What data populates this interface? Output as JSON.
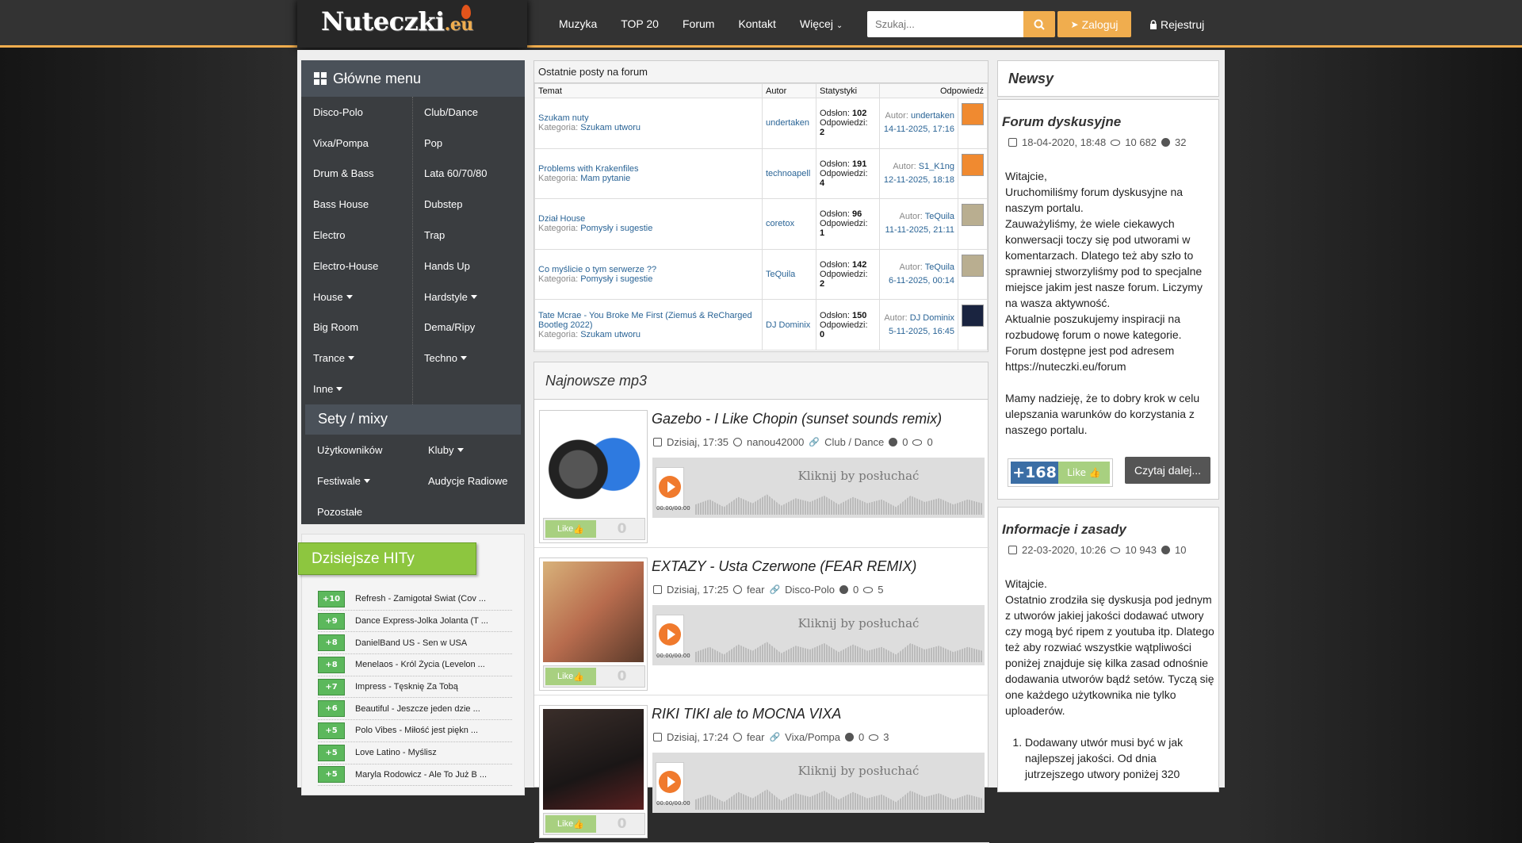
{
  "logo": {
    "text": "Nuteczki",
    "suffix": ".eu"
  },
  "nav": {
    "items": [
      "Muzyka",
      "TOP 20",
      "Forum",
      "Kontakt"
    ],
    "more": "Więcej"
  },
  "search": {
    "placeholder": "Szukaj..."
  },
  "auth": {
    "login": "Zaloguj",
    "register": "Rejestruj"
  },
  "sidebar": {
    "title": "Główne menu",
    "items": [
      {
        "label": "Disco-Polo",
        "caret": false
      },
      {
        "label": "Club/Dance",
        "caret": false
      },
      {
        "label": "Vixa/Pompa",
        "caret": false
      },
      {
        "label": "Pop",
        "caret": false
      },
      {
        "label": "Drum & Bass",
        "caret": false
      },
      {
        "label": "Lata 60/70/80",
        "caret": false
      },
      {
        "label": "Bass House",
        "caret": false
      },
      {
        "label": "Dubstep",
        "caret": false
      },
      {
        "label": "Electro",
        "caret": false
      },
      {
        "label": "Trap",
        "caret": false
      },
      {
        "label": "Electro-House",
        "caret": false
      },
      {
        "label": "Hands Up",
        "caret": false
      },
      {
        "label": "House",
        "caret": true
      },
      {
        "label": "Hardstyle",
        "caret": true
      },
      {
        "label": "Big Room",
        "caret": false
      },
      {
        "label": "Dema/Ripy",
        "caret": false
      },
      {
        "label": "Trance",
        "caret": true
      },
      {
        "label": "Techno",
        "caret": true
      },
      {
        "label": "Inne",
        "caret": true
      },
      {
        "label": "",
        "caret": false
      }
    ],
    "sety_title": "Sety / mixy",
    "sety": [
      {
        "label": "Użytkowników",
        "caret": false
      },
      {
        "label": "Kluby",
        "caret": true
      },
      {
        "label": "Festiwale",
        "caret": true
      },
      {
        "label": "Audycje Radiowe",
        "caret": false
      },
      {
        "label": "Pozostałe",
        "caret": false
      }
    ]
  },
  "hits": {
    "title": "Dzisiejsze HITy",
    "items": [
      {
        "score": "+10",
        "title": "Refresh - Zamigotał Świat (Cov ..."
      },
      {
        "score": "+9",
        "title": "Dance Express-Jolka Jolanta (T ..."
      },
      {
        "score": "+8",
        "title": "DanielBand US - Sen w USA"
      },
      {
        "score": "+8",
        "title": "Menelaos - Król Życia (Levelon ..."
      },
      {
        "score": "+7",
        "title": "Impress - Tęsknię Za Tobą"
      },
      {
        "score": "+6",
        "title": "Beautiful - Jeszcze jeden dzie ..."
      },
      {
        "score": "+5",
        "title": "Polo Vibes - Miłość jest piękn ..."
      },
      {
        "score": "+5",
        "title": "Love Latino - Myślisz"
      },
      {
        "score": "+5",
        "title": "Maryla Rodowicz - Ale To Już B ..."
      }
    ]
  },
  "forum": {
    "title": "Ostatnie posty na forum",
    "headers": [
      "Temat",
      "Autor",
      "Statystyki",
      "Odpowiedź"
    ],
    "cat_label": "Kategoria:",
    "views_label": "Odsłon:",
    "replies_label": "Odpowiedzi:",
    "author_label": "Autor:",
    "rows": [
      {
        "topic": "Szukam nuty",
        "category": "Szukam utworu",
        "author": "undertaken",
        "views": "102",
        "replies": "2",
        "last_author": "undertaken",
        "date": "14-11-2025, 17:16",
        "avatar": "#f08a30"
      },
      {
        "topic": "Problems with Krakenfiles",
        "category": "Mam pytanie",
        "author": "technoapell",
        "views": "191",
        "replies": "4",
        "last_author": "S1_K1ng",
        "date": "12-11-2025, 18:18",
        "avatar": "#f08a30"
      },
      {
        "topic": "Dział House",
        "category": "Pomysły i sugestie",
        "author": "coretox",
        "views": "96",
        "replies": "1",
        "last_author": "TeQuila",
        "date": "11-11-2025, 21:11",
        "avatar": "#b9ae90"
      },
      {
        "topic": "Co myślicie o tym serwerze ??",
        "category": "Pomysły i sugestie",
        "author": "TeQuila",
        "views": "142",
        "replies": "2",
        "last_author": "TeQuila",
        "date": "6-11-2025, 00:14",
        "avatar": "#b9ae90"
      },
      {
        "topic": "Tate Mcrae - You Broke Me First (Ziemuś & ReCharged Bootleg 2022)",
        "category": "Szukam utworu",
        "author": "DJ Dominix",
        "views": "150",
        "replies": "0",
        "last_author": "DJ Dominix",
        "date": "5-11-2025, 16:45",
        "avatar": "#1a2440"
      }
    ]
  },
  "mp3": {
    "title": "Najnowsze mp3",
    "like_label": "Like",
    "player_text": "Kliknij by posłuchać",
    "player_time": "00:00/00:00",
    "tracks": [
      {
        "title": "Gazebo - I Like Chopin (sunset sounds remix)",
        "date": "Dzisiaj, 17:35",
        "user": "nanou42000",
        "genre": "Club / Dance",
        "comments": "0",
        "views": "0",
        "likes": "0",
        "thumb": "speaker"
      },
      {
        "title": "EXTAZY - Usta Czerwone (FEAR REMIX)",
        "date": "Dzisiaj, 17:25",
        "user": "fear",
        "genre": "Disco-Polo",
        "comments": "0",
        "views": "5",
        "likes": "0",
        "thumb": "photo"
      },
      {
        "title": "RIKI TIKI ale to MOCNA VIXA",
        "date": "Dzisiaj, 17:24",
        "user": "fear",
        "genre": "Vixa/Pompa",
        "comments": "0",
        "views": "3",
        "likes": "0",
        "thumb": "dark"
      }
    ]
  },
  "news": {
    "title": "Newsy",
    "articles": [
      {
        "title": "Forum dyskusyjne",
        "date": "18-04-2020, 18:48",
        "views": "10 682",
        "comments": "32",
        "body": [
          "Witajcie,",
          "Uruchomiliśmy forum dyskusyjne na naszym portalu.",
          "Zauważyliśmy, że wiele ciekawych konwersacji toczy się pod utworami w komentarzach. Dlatego też aby szło to sprawniej stworzyliśmy pod to specjalne miejsce jakim jest nasze forum. Liczymy na wasza aktywność.",
          "Aktualnie poszukujemy inspiracji na rozbudowę forum o nowe kategorie.",
          "Forum dostępne jest pod adresem",
          "https://nuteczki.eu/forum",
          "",
          "Mamy nadzieję, że to dobry krok w celu ulepszania warunków do korzystania z naszego portalu."
        ],
        "likes": "+168",
        "like_label": "Like",
        "read_more": "Czytaj dalej..."
      },
      {
        "title": "Informacje i zasady",
        "date": "22-03-2020, 10:26",
        "views": "10 943",
        "comments": "10",
        "body": [
          "Witajcie.",
          "Ostatnio zrodziła się dyskusja pod jednym z utworów jakiej jakości dodawać utwory czy mogą być ripem z youtuba itp. Dlatego też aby rozwiać wszystkie wątpliwości poniżej znajduje się kilka zasad odnośnie dodawania utworów bądź setów. Tyczą się one każdego użytkownika nie tylko uploaderów."
        ],
        "list": [
          "Dodawany utwór musi być w jak najlepszej jakości. Od dnia jutrzejszego utwory poniżej 320"
        ]
      }
    ]
  },
  "colors": {
    "accent": "#f0ad4e",
    "topbar": "#333333",
    "sidebar": "#3a3d40",
    "hits": "#8dc63f",
    "link": "#2a6496"
  }
}
